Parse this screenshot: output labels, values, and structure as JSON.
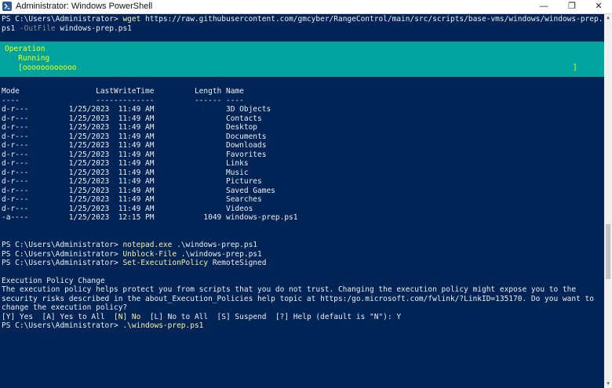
{
  "window": {
    "title": "Administrator: Windows PowerShell",
    "minimize_glyph": "—",
    "maximize_glyph": "❐",
    "close_glyph": "✕"
  },
  "colors": {
    "console_bg": "#012456",
    "console_text": "#eeedf0",
    "command_yellow": "#f9f1a5",
    "parameter_gray": "#8d8d8d",
    "progress_bg": "#00a39d",
    "progress_text": "#ffff00"
  },
  "wget_command": {
    "prompt": "PS C:\\Users\\Administrator> ",
    "cmd": "wget",
    "url": " https://raw.githubusercontent.com/gmcyber/RangeControl/main/src/scripts/base-vms/windows/windows-prep.",
    "url_cont": "ps1",
    "param": " -OutFile",
    "arg": " windows-prep.ps1"
  },
  "progress": {
    "line1": "Operation",
    "line2": "   Running",
    "bar": "   [oooooooooooo",
    "bar_end": "]"
  },
  "listing": {
    "header": "Mode                 LastWriteTime         Length Name",
    "separator": "----                 -------------         ------ ----",
    "rows": [
      "d-r---         1/25/2023  11:49 AM                3D Objects",
      "d-r---         1/25/2023  11:49 AM                Contacts",
      "d-r---         1/25/2023  11:49 AM                Desktop",
      "d-r---         1/25/2023  11:49 AM                Documents",
      "d-r---         1/25/2023  11:49 AM                Downloads",
      "d-r---         1/25/2023  11:49 AM                Favorites",
      "d-r---         1/25/2023  11:49 AM                Links",
      "d-r---         1/25/2023  11:49 AM                Music",
      "d-r---         1/25/2023  11:49 AM                Pictures",
      "d-r---         1/25/2023  11:49 AM                Saved Games",
      "d-r---         1/25/2023  11:49 AM                Searches",
      "d-r---         1/25/2023  11:49 AM                Videos",
      "-a----         1/25/2023  12:15 PM           1049 windows-prep.ps1"
    ]
  },
  "commands": {
    "notepad": {
      "prompt": "PS C:\\Users\\Administrator> ",
      "cmd": "notepad.exe",
      "arg": " .\\windows-prep.ps1"
    },
    "unblock": {
      "prompt": "PS C:\\Users\\Administrator> ",
      "cmd": "Unblock-File",
      "arg": " .\\windows-prep.ps1"
    },
    "setpolicy": {
      "prompt": "PS C:\\Users\\Administrator> ",
      "cmd": "Set-ExecutionPolicy",
      "arg": " RemoteSigned"
    }
  },
  "policy_message": {
    "title": "Execution Policy Change",
    "line1": "The execution policy helps protect you from scripts that you do not trust. Changing the execution policy might expose you to the",
    "line2": "security risks described in the about_Execution_Policies help topic at https:/go.microsoft.com/fwlink/?LinkID=135170. Do you want to",
    "line3": "change the execution policy?",
    "choices_a": "[Y] Yes  [A] Yes to All  ",
    "choices_no": "[N] No",
    "choices_b": "  [L] No to All  [S] Suspend  [?] Help (default is \"N\"): Y"
  },
  "final_command": {
    "prompt": "PS C:\\Users\\Administrator> ",
    "cmd": ".\\windows-prep.ps1"
  }
}
